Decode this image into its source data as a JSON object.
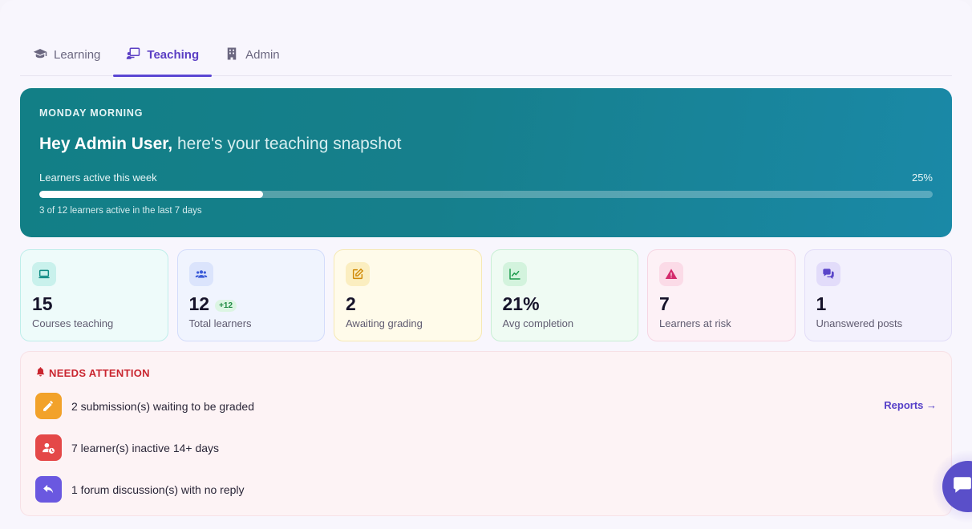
{
  "tabs": [
    {
      "label": "Learning",
      "icon": "graduation-cap-icon",
      "active": false
    },
    {
      "label": "Teaching",
      "icon": "teacher-board-icon",
      "active": true
    },
    {
      "label": "Admin",
      "icon": "building-icon",
      "active": false
    }
  ],
  "hero": {
    "eyebrow": "MONDAY MORNING",
    "greeting_name": "Hey Admin User,",
    "greeting_rest": " here's your teaching snapshot",
    "progress_label": "Learners active this week",
    "progress_percent_text": "25%",
    "progress_fraction": 0.25,
    "progress_note": "3 of 12 learners active in the last 7 days"
  },
  "stats": [
    {
      "value": "15",
      "label": "Courses teaching",
      "icon": "laptop-icon",
      "bg": "#eefbfa",
      "border": "#bfeeea",
      "icon_bg": "#c9f1ec",
      "icon_color": "#0e8a83"
    },
    {
      "value": "12",
      "badge": "+12",
      "label": "Total learners",
      "icon": "users-icon",
      "bg": "#f0f4fe",
      "border": "#d3dcfb",
      "icon_bg": "#dbe4fc",
      "icon_color": "#3b5bd8"
    },
    {
      "value": "2",
      "label": "Awaiting grading",
      "icon": "edit-icon",
      "bg": "#fffbea",
      "border": "#f6e9b4",
      "icon_bg": "#fbeec0",
      "icon_color": "#d08a07"
    },
    {
      "value": "21%",
      "label": "Avg completion",
      "icon": "chart-line-icon",
      "bg": "#effbf3",
      "border": "#c9efd5",
      "icon_bg": "#d3f3dd",
      "icon_color": "#1c9a4b"
    },
    {
      "value": "7",
      "label": "Learners at risk",
      "icon": "warning-icon",
      "bg": "#fdf1f6",
      "border": "#f6d6e3",
      "icon_bg": "#fbdbe7",
      "icon_color": "#d42a6c"
    },
    {
      "value": "1",
      "label": "Unanswered posts",
      "icon": "chat-bubbles-icon",
      "bg": "#f3f1fd",
      "border": "#e2ddf8",
      "icon_bg": "#e2dcfa",
      "icon_color": "#5a45c9"
    }
  ],
  "attention": {
    "title": "NEEDS ATTENTION",
    "reports_link": "Reports →",
    "items": [
      {
        "text": "2 submission(s) waiting to be graded",
        "icon": "pencil-icon",
        "color": "#f2a22a"
      },
      {
        "text": "7 learner(s) inactive 14+ days",
        "icon": "user-clock-icon",
        "color": "#e44848"
      },
      {
        "text": "1 forum discussion(s) with no reply",
        "icon": "reply-icon",
        "color": "#6a58e0"
      }
    ]
  },
  "colors": {
    "accent": "#5b46d3",
    "hero_start": "#127f86",
    "hero_end": "#1a89a7",
    "attention_title": "#c9252f"
  }
}
